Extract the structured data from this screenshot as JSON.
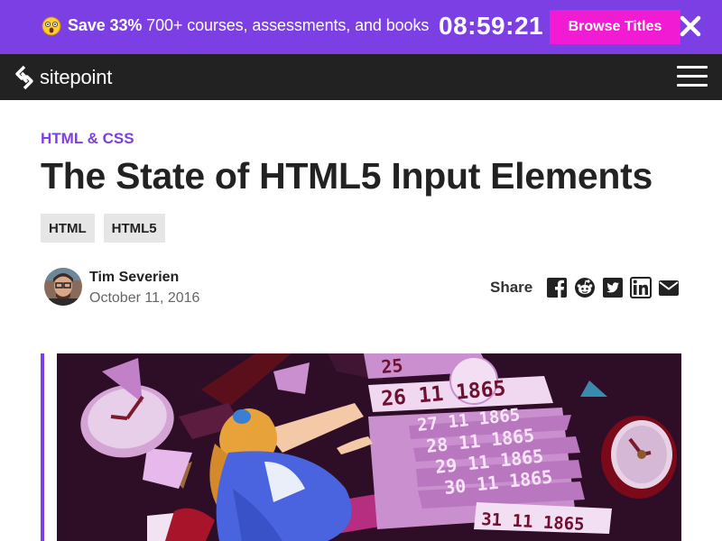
{
  "promo": {
    "emoji_icon": "shocked-face-emoji",
    "highlight": "Save 33%",
    "text": " 700+ courses, assessments, and books",
    "timer": "08:59:21",
    "button_label": "Browse Titles",
    "close_icon": "close-icon"
  },
  "nav": {
    "logo_text": "sitepoint",
    "menu_icon": "hamburger-menu-icon"
  },
  "article": {
    "category": "HTML & CSS",
    "title": "The State of HTML5 Input Elements",
    "tags": [
      "HTML",
      "HTML5"
    ],
    "author": {
      "name": "Tim Severien",
      "date": "October 11, 2016"
    },
    "share": {
      "label": "Share",
      "icons": [
        "facebook-icon",
        "reddit-icon",
        "twitter-icon",
        "linkedin-icon",
        "email-icon"
      ]
    },
    "hero": {
      "dates": [
        "25",
        "26 11 1865",
        "27 11 1865",
        "28 11 1865",
        "29 11 1865",
        "30 11 1865",
        "31 11 1865"
      ]
    }
  },
  "colors": {
    "brand_purple": "#7b3fe4",
    "promo_button": "#f21bd4",
    "nav_bg": "#222222",
    "tag_bg": "#e6e6e6"
  }
}
